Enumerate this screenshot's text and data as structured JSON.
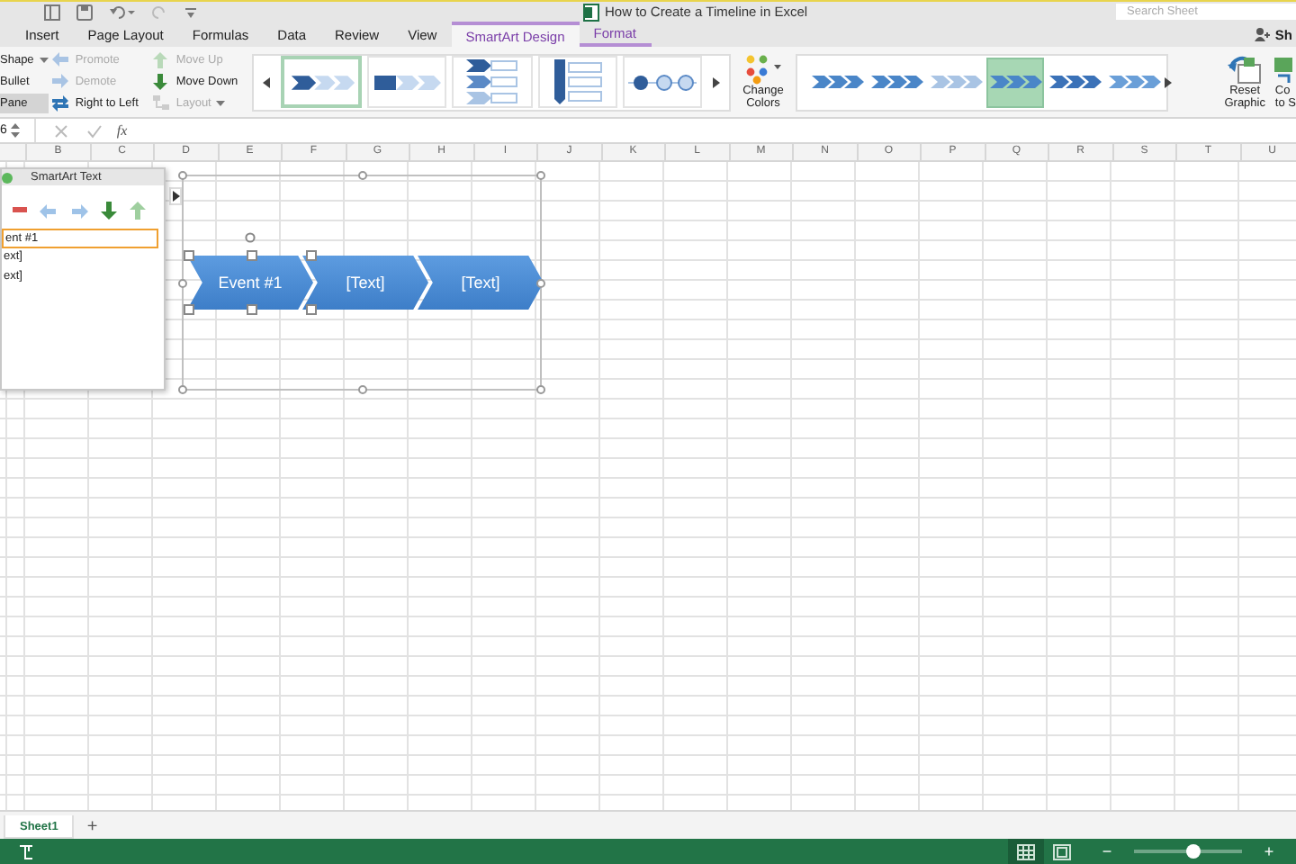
{
  "window": {
    "title": "How to Create a Timeline in Excel"
  },
  "search": {
    "placeholder": "Search Sheet"
  },
  "share": {
    "label": "Sh"
  },
  "tabs": [
    {
      "label": "Insert",
      "selected": false,
      "contextual": false
    },
    {
      "label": "Page Layout",
      "selected": false,
      "contextual": false
    },
    {
      "label": "Formulas",
      "selected": false,
      "contextual": false
    },
    {
      "label": "Data",
      "selected": false,
      "contextual": false
    },
    {
      "label": "Review",
      "selected": false,
      "contextual": false
    },
    {
      "label": "View",
      "selected": false,
      "contextual": false
    },
    {
      "label": "SmartArt Design",
      "selected": true,
      "contextual": true
    },
    {
      "label": "Format",
      "selected": false,
      "contextual": true
    }
  ],
  "ribbon": {
    "command_columns": [
      [
        {
          "kind": "plain",
          "label": "Shape",
          "dropdown": true,
          "disabled": false,
          "on": false
        },
        {
          "kind": "plain",
          "label": "Bullet",
          "dropdown": false,
          "disabled": false,
          "on": false
        },
        {
          "kind": "plain",
          "label": "Pane",
          "dropdown": false,
          "disabled": false,
          "on": true
        }
      ],
      [
        {
          "kind": "promote",
          "label": "Promote",
          "dropdown": false,
          "disabled": true,
          "on": false
        },
        {
          "kind": "demote",
          "label": "Demote",
          "dropdown": false,
          "disabled": true,
          "on": false
        },
        {
          "kind": "swap",
          "label": "Right to Left",
          "dropdown": false,
          "disabled": false,
          "on": false
        }
      ],
      [
        {
          "kind": "up",
          "label": "Move Up",
          "dropdown": false,
          "disabled": true,
          "on": false
        },
        {
          "kind": "down",
          "label": "Move Down",
          "dropdown": false,
          "disabled": false,
          "on": false
        },
        {
          "kind": "layout",
          "label": "Layout",
          "dropdown": true,
          "disabled": true,
          "on": false
        }
      ]
    ],
    "layout_gallery": [
      {
        "kind": "chevron-row",
        "selected": true
      },
      {
        "kind": "block-row",
        "selected": false
      },
      {
        "kind": "stacked",
        "selected": false
      },
      {
        "kind": "vertical-list",
        "selected": false
      },
      {
        "kind": "circle-line",
        "selected": false
      }
    ],
    "change_colors": {
      "label": "Change Colors"
    },
    "style_gallery": [
      {
        "kind": "flat",
        "selected": false
      },
      {
        "kind": "flat",
        "selected": false
      },
      {
        "kind": "faded",
        "selected": false
      },
      {
        "kind": "flat",
        "selected": true
      },
      {
        "kind": "shaded",
        "selected": false
      },
      {
        "kind": "slanted",
        "selected": false
      }
    ],
    "reset_graphic": {
      "label": "Reset Graphic"
    },
    "convert": {
      "lines": [
        "Co",
        "to S"
      ]
    }
  },
  "formula_bar": {
    "name_box": "6",
    "function_label": "fx"
  },
  "columns": [
    "B",
    "C",
    "D",
    "E",
    "F",
    "G",
    "H",
    "I",
    "J",
    "K",
    "L",
    "M",
    "N",
    "O",
    "P",
    "Q",
    "R",
    "S",
    "T",
    "U"
  ],
  "text_pane": {
    "title": "SmartArt Text",
    "items": [
      {
        "text": "ent #1",
        "selected": true
      },
      {
        "text": "ext]",
        "selected": false
      },
      {
        "text": "ext]",
        "selected": false
      }
    ]
  },
  "smartart": {
    "shapes": [
      {
        "text": "Event #1",
        "selected": true
      },
      {
        "text": "[Text]",
        "selected": false
      },
      {
        "text": "[Text]",
        "selected": false
      }
    ]
  },
  "sheet_tabs": [
    {
      "label": "Sheet1",
      "selected": true
    }
  ],
  "add_sheet": "+",
  "status_bar": {
    "views": [
      {
        "kind": "normal",
        "selected": true
      },
      {
        "kind": "page-layout",
        "selected": false
      }
    ],
    "zoom_out": "−",
    "zoom_in": "+",
    "zoom": {
      "level": 0.55
    }
  }
}
